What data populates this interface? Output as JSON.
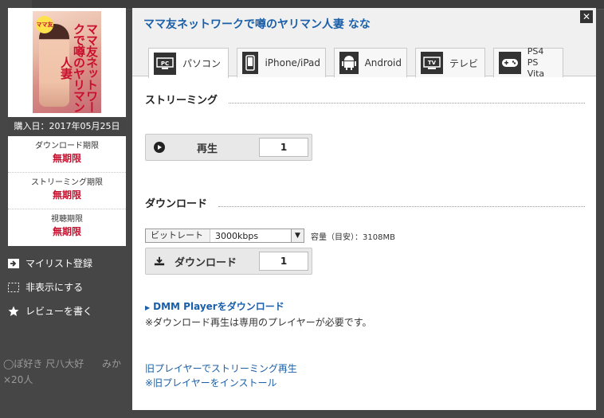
{
  "background": {
    "item1": "◯ぽ好き 尺八大好",
    "item2": "みか",
    "item3": "×20人"
  },
  "product": {
    "cover_title": "ママ友ネットワークで噂のヤリマン人妻",
    "cover_badge": "ママ友",
    "purchase": "購入日：2017年05月25日",
    "limits": [
      {
        "label": "ダウンロード期限",
        "value": "無期限"
      },
      {
        "label": "ストリーミング期限",
        "value": "無期限"
      },
      {
        "label": "視聴期限",
        "value": "無期限"
      }
    ]
  },
  "left_actions": [
    {
      "label": "マイリスト登録",
      "icon": "mylist-icon"
    },
    {
      "label": "非表示にする",
      "icon": "hide-icon"
    },
    {
      "label": "レビューを書く",
      "icon": "star-icon"
    }
  ],
  "modal": {
    "title": "ママ友ネットワークで噂のヤリマン人妻 なな",
    "close": "✕",
    "tabs": [
      {
        "icon_text": "PC",
        "label": "パソコン"
      },
      {
        "icon_text": "▯",
        "label": "iPhone/iPad"
      },
      {
        "icon_text": "🤖",
        "label": "Android"
      },
      {
        "icon_text": "TV",
        "label": "テレビ"
      },
      {
        "icon_text": "🎮",
        "label": "PS4",
        "label2": "PS Vita"
      }
    ],
    "streaming": {
      "heading": "ストリーミング",
      "button": "再生",
      "count": "1"
    },
    "download": {
      "heading": "ダウンロード",
      "bitrate_label": "ビットレート",
      "bitrate_value": "3000kbps",
      "capacity": "容量（目安）：3108MB",
      "button": "ダウンロード",
      "count": "1"
    },
    "player_link": "DMM Playerをダウンロード",
    "player_note": "※ダウンロード再生は専用のプレイヤーが必要です。",
    "old_player_stream": "旧プレイヤーでストリーミング再生",
    "old_player_install": "※旧プレイヤーをインストール"
  }
}
